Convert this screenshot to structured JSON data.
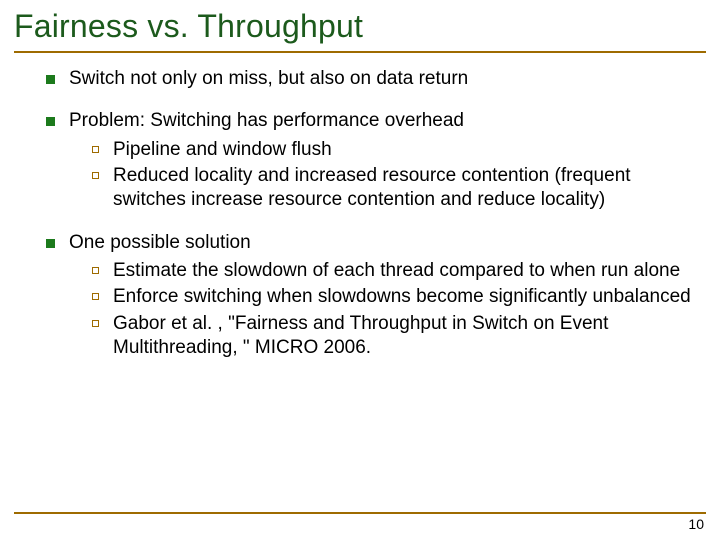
{
  "title": "Fairness vs. Throughput",
  "bullets": [
    {
      "text": "Switch not only on miss, but also on data return",
      "sub": []
    },
    {
      "text": "Problem: Switching has performance overhead",
      "sub": [
        "Pipeline and window flush",
        "Reduced locality and increased resource contention (frequent switches increase resource contention and reduce locality)"
      ]
    },
    {
      "text": "One possible solution",
      "sub": [
        "Estimate the slowdown of each thread compared to when run alone",
        "Enforce switching when slowdowns become significantly unbalanced",
        "Gabor et al. , \"Fairness and Throughput in Switch on Event Multithreading, \" MICRO 2006."
      ]
    }
  ],
  "page_number": "10"
}
